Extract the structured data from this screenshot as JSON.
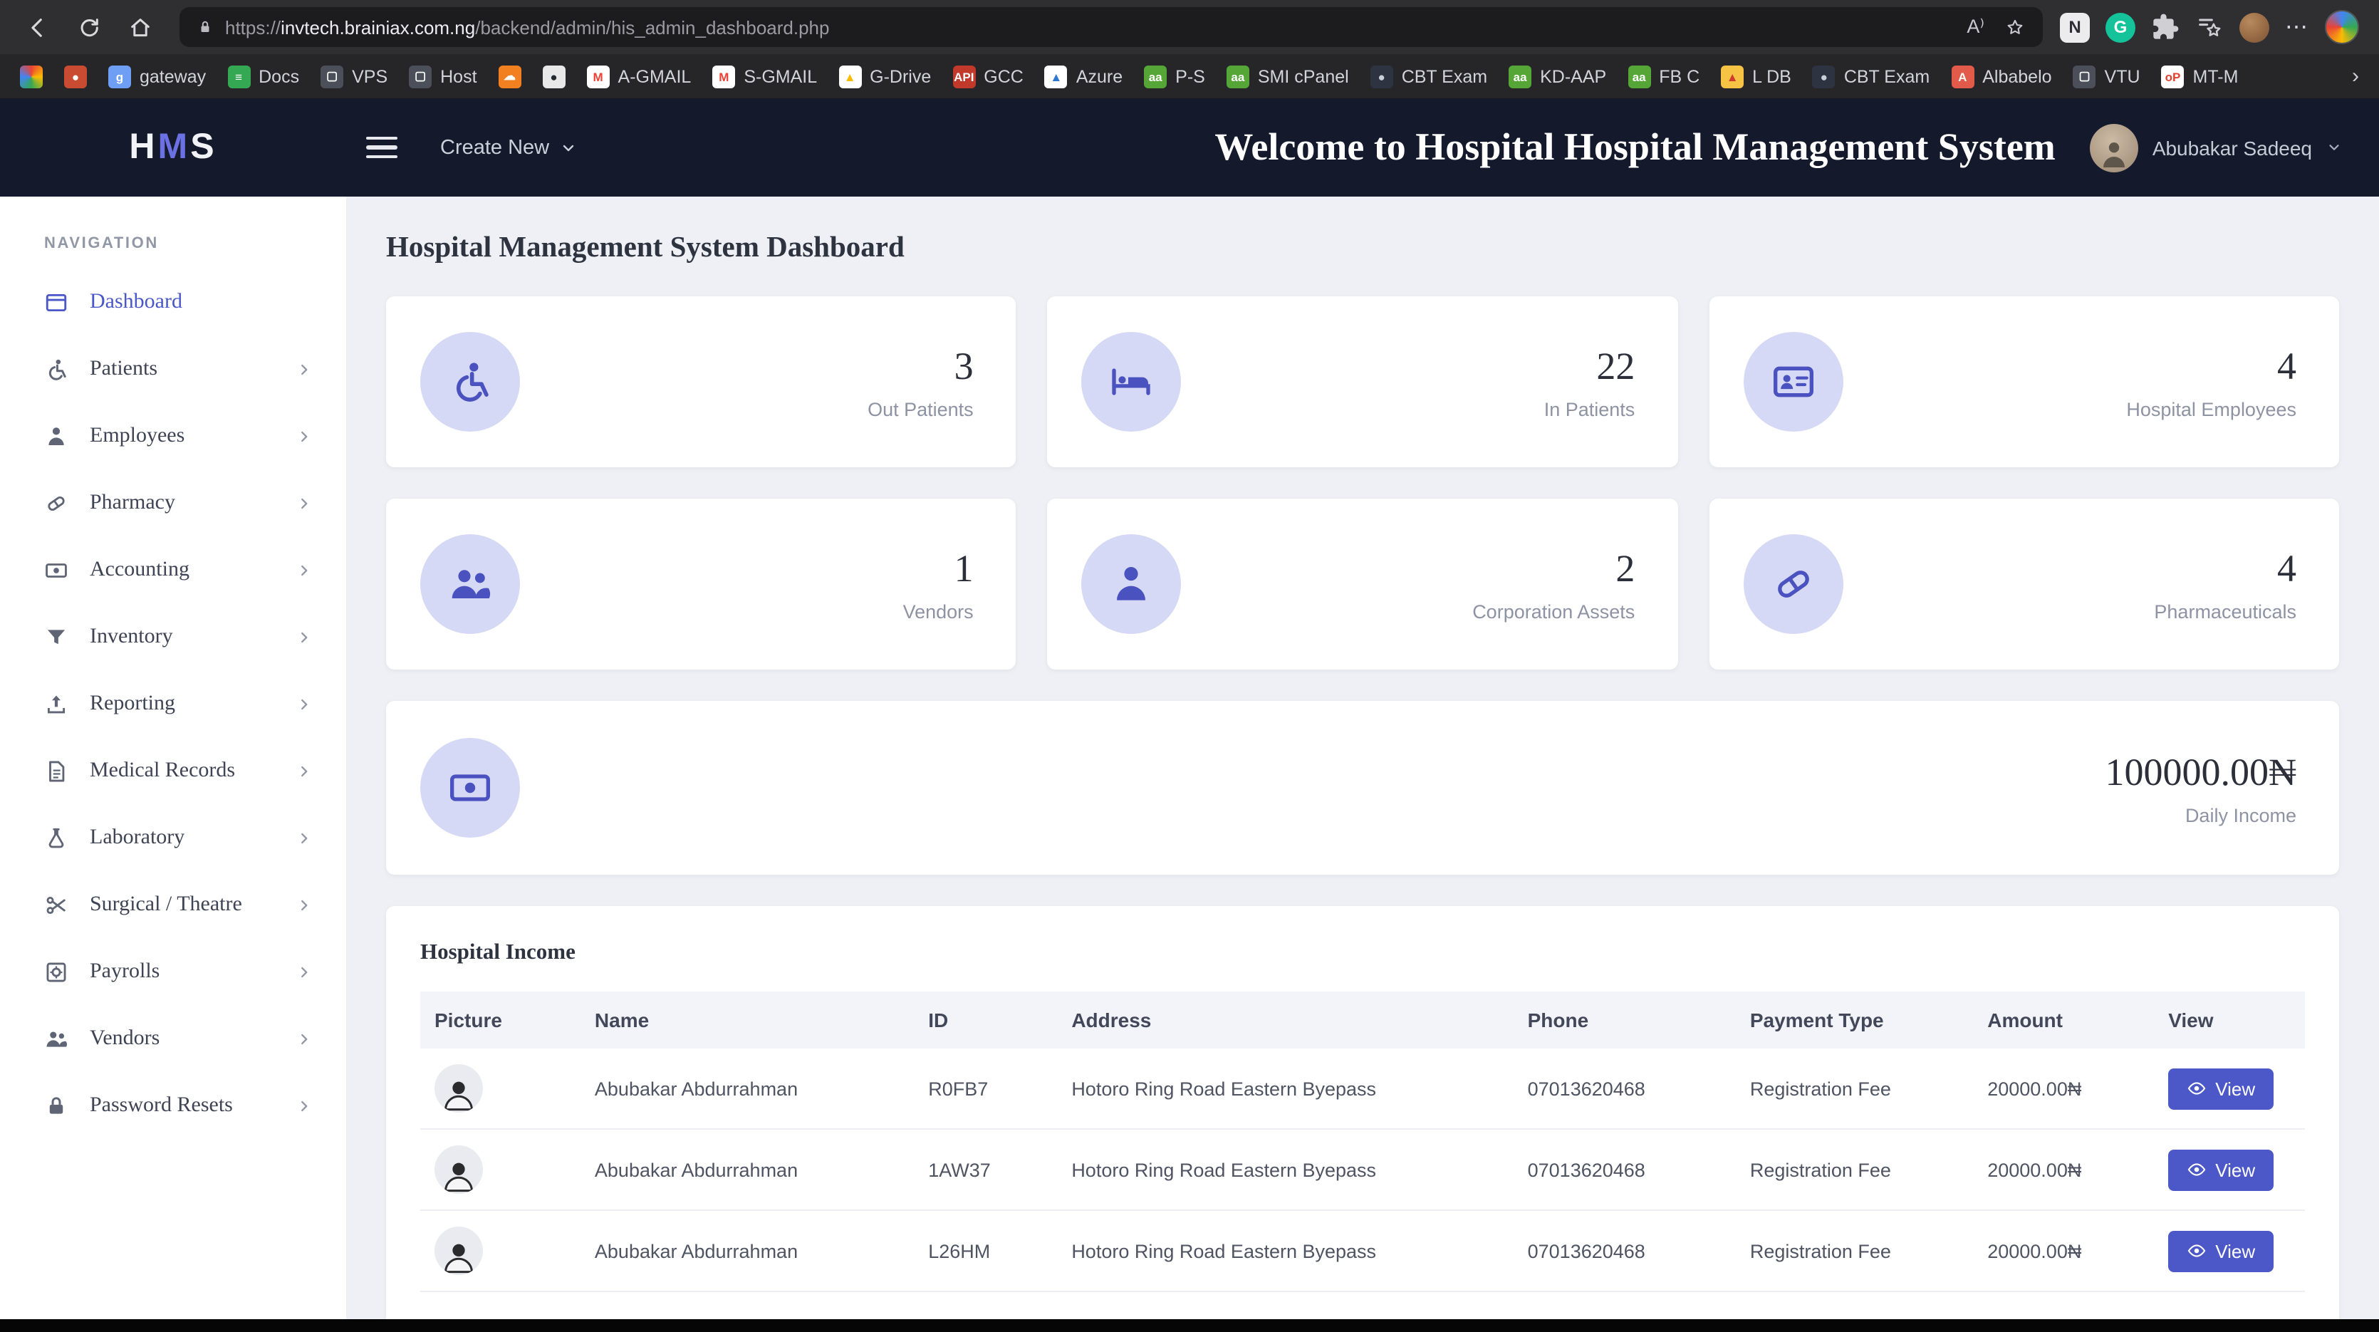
{
  "colors": {
    "accent": "#4c58c7",
    "header_bg": "#141a2b",
    "stat_icon_bg": "#d6d9f6",
    "stat_icon_fg": "#4a52c0",
    "main_bg": "#eff0f6"
  },
  "browser": {
    "address": {
      "scheme": "https://",
      "domain": "invtech.brainiax.com.ng",
      "path": "/backend/admin/his_admin_dashboard.php"
    },
    "toolbar": {
      "reader_glyph": "A⁾",
      "n_badge": "N",
      "grammarly_badge": "G",
      "ellipsis": "⋯"
    },
    "bookmarks_overflow": "›",
    "bookmarks": [
      {
        "label": "",
        "glyph": "",
        "color": "conic-gradient(#ea4335,#fbbc04,#34a853,#4285f4,#ea4335)",
        "fg": "#fff"
      },
      {
        "label": "",
        "glyph": "●",
        "color": "#c94b32",
        "fg": "#ffffff"
      },
      {
        "label": "gateway",
        "glyph": "g",
        "color": "#6f9ff5",
        "fg": "#ffffff"
      },
      {
        "label": "Docs",
        "glyph": "≡",
        "color": "#34a853",
        "fg": "#ffffff"
      },
      {
        "label": "VPS",
        "glyph": "▢",
        "color": "#4a4f5a",
        "fg": "#ffffff"
      },
      {
        "label": "Host",
        "glyph": "▢",
        "color": "#4a4f5a",
        "fg": "#ffffff"
      },
      {
        "label": "",
        "glyph": "☁",
        "color": "#f38020",
        "fg": "#ffffff"
      },
      {
        "label": "",
        "glyph": "●",
        "color": "#e8e8e8",
        "fg": "#24292f"
      },
      {
        "label": "A-GMAIL",
        "glyph": "M",
        "color": "#ffffff",
        "fg": "#ea4335"
      },
      {
        "label": "S-GMAIL",
        "glyph": "M",
        "color": "#ffffff",
        "fg": "#ea4335"
      },
      {
        "label": "G-Drive",
        "glyph": "▲",
        "color": "#ffffff",
        "fg": "#fbbc04"
      },
      {
        "label": "GCC",
        "glyph": "API",
        "color": "#c0392b",
        "fg": "#ffffff"
      },
      {
        "label": "Azure",
        "glyph": "▲",
        "color": "#ffffff",
        "fg": "#2f76d2"
      },
      {
        "label": "P-S",
        "glyph": "aa",
        "color": "#56a537",
        "fg": "#ffffff"
      },
      {
        "label": "SMI cPanel",
        "glyph": "aa",
        "color": "#56a537",
        "fg": "#ffffff"
      },
      {
        "label": "CBT Exam",
        "glyph": "●",
        "color": "#2d3340",
        "fg": "#c9ced8"
      },
      {
        "label": "KD-AAP",
        "glyph": "aa",
        "color": "#56a537",
        "fg": "#ffffff"
      },
      {
        "label": "FB C",
        "glyph": "aa",
        "color": "#56a537",
        "fg": "#ffffff"
      },
      {
        "label": "L DB",
        "glyph": "▲",
        "color": "#f6c344",
        "fg": "#d03b2e"
      },
      {
        "label": "CBT Exam",
        "glyph": "●",
        "color": "#2d3340",
        "fg": "#c9ced8"
      },
      {
        "label": "Albabelo",
        "glyph": "A",
        "color": "#e25b4a",
        "fg": "#ffffff"
      },
      {
        "label": "VTU",
        "glyph": "▢",
        "color": "#4a4f5a",
        "fg": "#ffffff"
      },
      {
        "label": "MT-M",
        "glyph": "oP",
        "color": "#ffffff",
        "fg": "#e2402e"
      }
    ]
  },
  "header": {
    "logo_h": "H",
    "logo_m": "M",
    "logo_s": "S",
    "create_new_label": "Create New",
    "welcome": "Welcome to Hospital Hospital Management System",
    "user_name": "Abubakar Sadeeq"
  },
  "sidebar": {
    "section_label": "NAVIGATION",
    "items": [
      {
        "label": "Dashboard",
        "icon": "icon-dashboard",
        "active": true,
        "has_children": false
      },
      {
        "label": "Patients",
        "icon": "icon-patients",
        "has_children": true
      },
      {
        "label": "Employees",
        "icon": "icon-person",
        "has_children": true
      },
      {
        "label": "Pharmacy",
        "icon": "icon-pharmacy",
        "has_children": true
      },
      {
        "label": "Accounting",
        "icon": "icon-banknote",
        "has_children": true
      },
      {
        "label": "Inventory",
        "icon": "icon-funnel",
        "has_children": true
      },
      {
        "label": "Reporting",
        "icon": "icon-upload",
        "has_children": true
      },
      {
        "label": "Medical Records",
        "icon": "icon-document",
        "has_children": true
      },
      {
        "label": "Laboratory",
        "icon": "icon-flask",
        "has_children": true
      },
      {
        "label": "Surgical / Theatre",
        "icon": "icon-scissors",
        "has_children": true
      },
      {
        "label": "Payrolls",
        "icon": "icon-safe",
        "has_children": true
      },
      {
        "label": "Vendors",
        "icon": "icon-people",
        "has_children": true
      },
      {
        "label": "Password Resets",
        "icon": "icon-lock-filled",
        "has_children": true
      }
    ]
  },
  "main": {
    "title": "Hospital Management System Dashboard",
    "stats": [
      {
        "value": "3",
        "label": "Out Patients",
        "icon": "icon-patients"
      },
      {
        "value": "22",
        "label": "In Patients",
        "icon": "icon-bed"
      },
      {
        "value": "4",
        "label": "Hospital Employees",
        "icon": "icon-idcard"
      },
      {
        "value": "1",
        "label": "Vendors",
        "icon": "icon-people"
      },
      {
        "value": "2",
        "label": "Corporation Assets",
        "icon": "icon-person"
      },
      {
        "value": "4",
        "label": "Pharmaceuticals",
        "icon": "icon-pharmacy"
      }
    ],
    "income": {
      "value": "100000.00₦",
      "label": "Daily Income",
      "icon": "icon-banknote"
    },
    "table": {
      "title": "Hospital Income",
      "headers": [
        "Picture",
        "Name",
        "ID",
        "Address",
        "Phone",
        "Payment Type",
        "Amount",
        "View"
      ],
      "rows": [
        {
          "name": "Abubakar Abdurrahman",
          "id": "R0FB7",
          "address": "Hotoro Ring Road Eastern Byepass",
          "phone": "07013620468",
          "payment_type": "Registration Fee",
          "amount": "20000.00₦",
          "view": "View"
        },
        {
          "name": "Abubakar Abdurrahman",
          "id": "1AW37",
          "address": "Hotoro Ring Road Eastern Byepass",
          "phone": "07013620468",
          "payment_type": "Registration Fee",
          "amount": "20000.00₦",
          "view": "View"
        },
        {
          "name": "Abubakar Abdurrahman",
          "id": "L26HM",
          "address": "Hotoro Ring Road Eastern Byepass",
          "phone": "07013620468",
          "payment_type": "Registration Fee",
          "amount": "20000.00₦",
          "view": "View"
        }
      ]
    }
  }
}
